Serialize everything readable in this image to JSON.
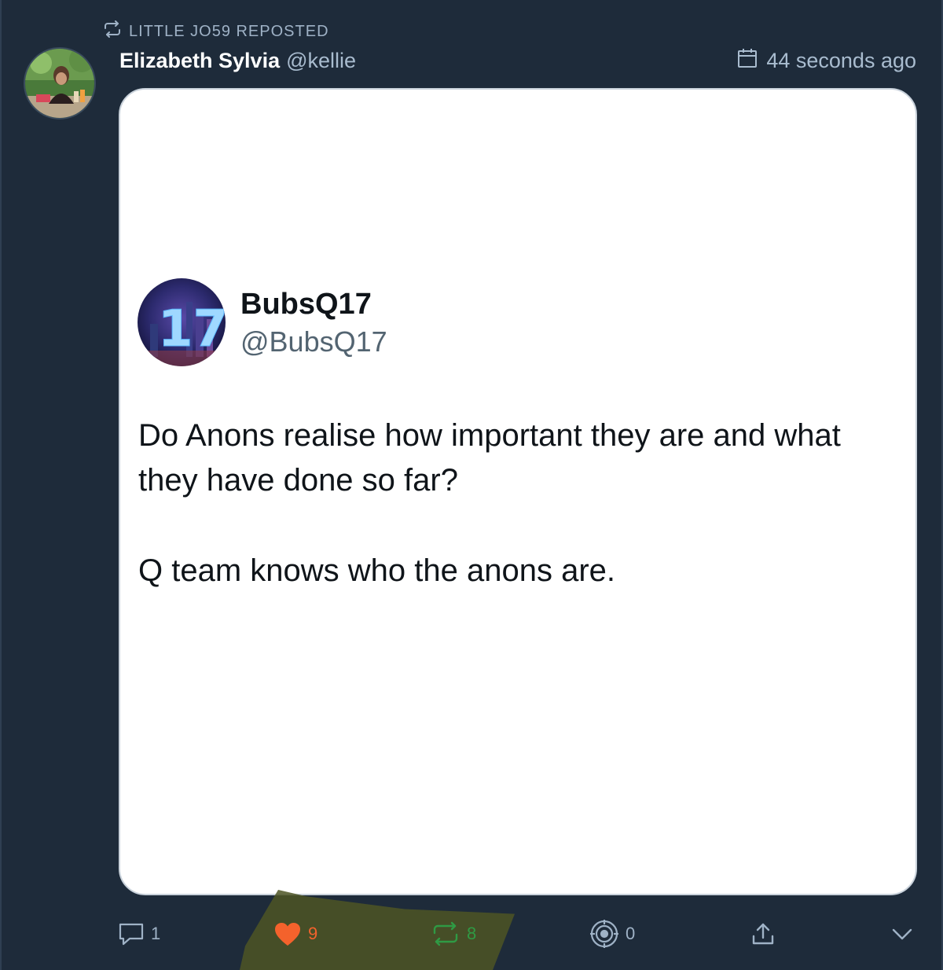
{
  "repost": {
    "label": "LITTLE JO59 REPOSTED",
    "icon": "repost-icon"
  },
  "post": {
    "author_name": "Elizabeth Sylvia",
    "author_handle": "@kellie",
    "timestamp": "44 seconds ago"
  },
  "quoted": {
    "name": "BubsQ17",
    "handle": "@BubsQ17",
    "avatar_text": "17",
    "paragraphs": [
      "Do Anons realise how important they are and what they have done so far?",
      "Q team knows who the anons are."
    ]
  },
  "actions": {
    "reply_count": "1",
    "like_count": "9",
    "repost_count": "8",
    "quote_count": "0"
  },
  "colors": {
    "background": "#1e2b3a",
    "like": "#f4622c",
    "repost": "#2f9a44",
    "muted": "#9fb2c6"
  }
}
